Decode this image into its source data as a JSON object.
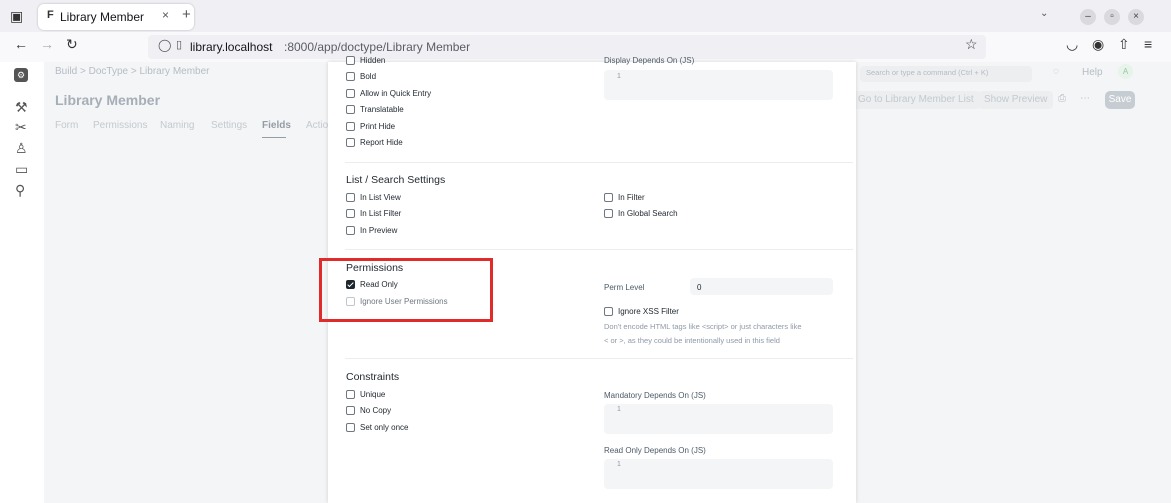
{
  "browser": {
    "tab_title": "Library Member",
    "tab_favicon": "F",
    "url_host": "library.localhost",
    "url_rest": ":8000/app/doctype/Library Member"
  },
  "header": {
    "breadcrumb": "Build  >  DocType  >  Library Member",
    "search_placeholder": "Search or type a command (Ctrl + K)",
    "help_label": "Help",
    "avatar_letter": "A",
    "title": "Library Member",
    "go_to_list_label": "Go to Library Member List",
    "show_preview_label": "Show Preview",
    "save_label": "Save"
  },
  "page_tabs": [
    "Form",
    "Permissions",
    "Naming",
    "Settings",
    "Fields",
    "Actions"
  ],
  "modal": {
    "top_checkboxes": [
      "Hidden",
      "Bold",
      "Allow in Quick Entry",
      "Translatable",
      "Print Hide",
      "Report Hide"
    ],
    "display_depends_label": "Display Depends On (JS)",
    "list_search": {
      "title": "List / Search Settings",
      "left": [
        "In List View",
        "In List Filter",
        "In Preview"
      ],
      "right": [
        "In Filter",
        "In Global Search"
      ]
    },
    "permissions": {
      "title": "Permissions",
      "read_only": "Read Only",
      "ignore_user_permissions": "Ignore User Permissions",
      "perm_level_label": "Perm Level",
      "perm_level_value": "0",
      "ignore_xss_label": "Ignore XSS Filter",
      "ignore_xss_desc_1": "Don't encode HTML tags like <script> or just characters like",
      "ignore_xss_desc_2": "< or >, as they could be intentionally used in this field"
    },
    "constraints": {
      "title": "Constraints",
      "left": [
        "Unique",
        "No Copy",
        "Set only once"
      ],
      "mandatory_depends_label": "Mandatory Depends On (JS)",
      "read_only_depends_label": "Read Only Depends On (JS)"
    },
    "line_number": "1"
  },
  "colors": {
    "highlight": "#e12b2b",
    "text": "#1f272e"
  }
}
